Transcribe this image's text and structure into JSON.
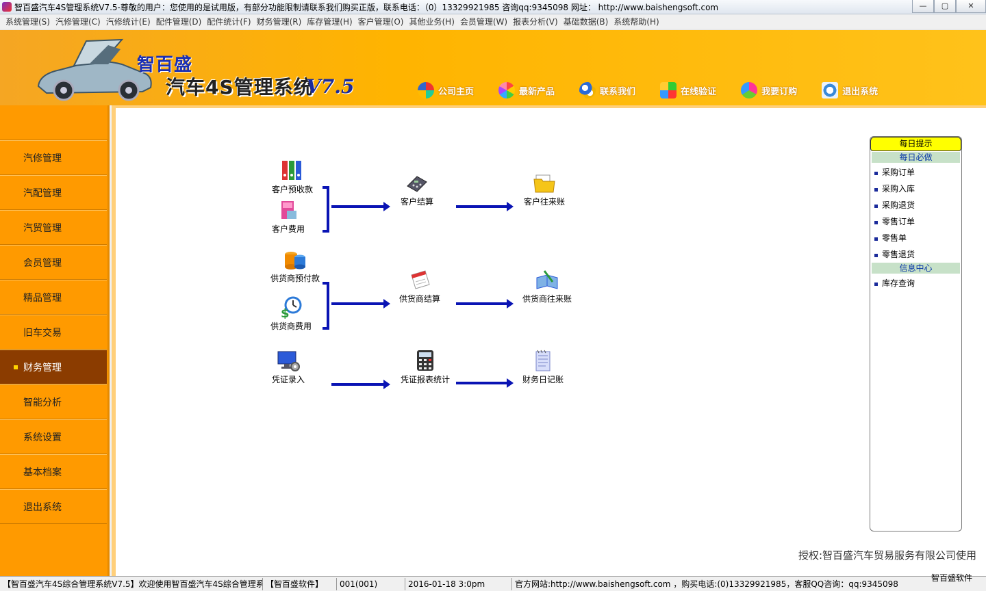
{
  "window": {
    "title": "智百盛汽车4S管理系统V7.5-尊敬的用户：您使用的是试用版，有部分功能限制请联系我们购买正版，联系电话：（0）13329921985  咨询qq:9345098   网址： http://www.baishengsoft.com",
    "minimize": "—",
    "maximize": "▢",
    "close": "✕"
  },
  "menu": [
    "系统管理(S)",
    "汽修管理(C)",
    "汽修统计(E)",
    "配件管理(D)",
    "配件统计(F)",
    "财务管理(R)",
    "库存管理(H)",
    "客户管理(O)",
    "其他业务(H)",
    "会员管理(W)",
    "报表分析(V)",
    "基础数据(B)",
    "系统帮助(H)"
  ],
  "banner": {
    "brand": "智百盛",
    "system": "汽车4S管理系统",
    "version": "V7.5",
    "links": [
      {
        "label": "公司主页",
        "icon": "pie-icon"
      },
      {
        "label": "最新产品",
        "icon": "flower-icon"
      },
      {
        "label": "联系我们",
        "icon": "chain-icon"
      },
      {
        "label": "在线验证",
        "icon": "pinwheel-icon"
      },
      {
        "label": "我要订购",
        "icon": "gem-icon"
      },
      {
        "label": "退出系统",
        "icon": "exit-icon"
      }
    ]
  },
  "sidebar": {
    "items": [
      "汽修管理",
      "汽配管理",
      "汽贸管理",
      "会员管理",
      "精品管理",
      "旧车交易",
      "财务管理",
      "智能分析",
      "系统设置",
      "基本档案",
      "退出系统"
    ],
    "active_index": 6
  },
  "flow": {
    "customer_prepay": "客户预收款",
    "customer_fee": "客户费用",
    "customer_settle": "客户结算",
    "customer_account": "客户往来账",
    "supplier_prepay": "供货商预付款",
    "supplier_fee": "供货商费用",
    "supplier_settle": "供货商结算",
    "supplier_account": "供货商往来账",
    "voucher_entry": "凭证录入",
    "voucher_report": "凭证报表统计",
    "finance_journal": "财务日记账"
  },
  "tips": {
    "header": "每日提示",
    "section1": "每日必做",
    "section1_items": [
      "采购订单",
      "采购入库",
      "采购退货",
      "零售订单",
      "零售单",
      "零售退货"
    ],
    "section2": "信息中心",
    "section2_items": [
      "库存查询"
    ]
  },
  "copyright": "授权:智百盛汽车贸易服务有限公司使用",
  "status": {
    "cell1": "【智百盛汽车4S综合管理系统V7.5】欢迎使用智百盛汽车4S综合管理系",
    "cell2": "【智百盛软件】",
    "cell3": "001(001)",
    "cell4": "2016-01-18 3:0pm",
    "cell5": "官方网站:http://www.baishengsoft.com ，购买电话:(0)13329921985，客服QQ咨询：qq:9345098",
    "corner": "智百盛软件"
  }
}
